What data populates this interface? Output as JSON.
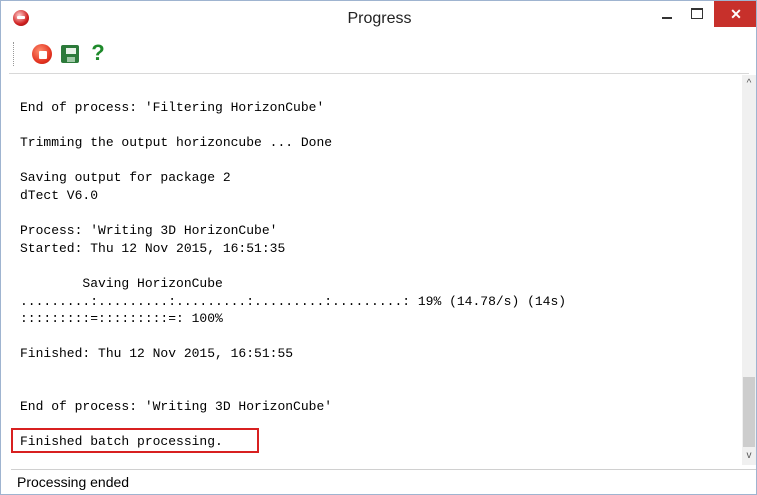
{
  "window": {
    "title": "Progress",
    "close_glyph": "✕",
    "help_glyph": "?"
  },
  "toolbar": {
    "buttons": [
      {
        "name": "stop-icon",
        "color": "#e2301e"
      },
      {
        "name": "save-icon",
        "color": "#2c7a3a"
      },
      {
        "name": "help-icon",
        "color": "#1f8a2b"
      }
    ]
  },
  "log": {
    "lines": [
      "End of process: 'Filtering HorizonCube'",
      "",
      "Trimming the output horizoncube ... Done",
      "",
      "Saving output for package 2",
      "dTect V6.0",
      "",
      "Process: 'Writing 3D HorizonCube'",
      "Started: Thu 12 Nov 2015, 16:51:35",
      "",
      "        Saving HorizonCube",
      ".........:.........:.........:.........:.........: 19% (14.78/s) (14s)",
      ":::::::::=:::::::::=: 100%",
      "",
      "Finished: Thu 12 Nov 2015, 16:51:55",
      "",
      "",
      "End of process: 'Writing 3D HorizonCube'",
      "",
      "Finished batch processing."
    ],
    "highlighted_line": "Finished batch processing.",
    "highlight_color": "#d82020"
  },
  "scrollbar": {
    "up_glyph": "^",
    "down_glyph": "v"
  },
  "status": {
    "text": "Processing ended"
  }
}
